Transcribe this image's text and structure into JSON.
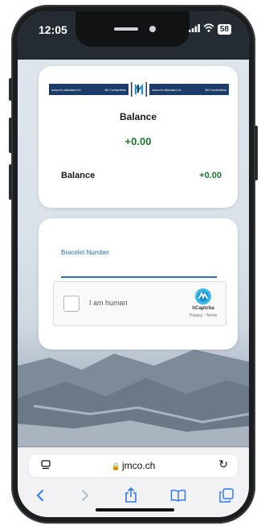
{
  "status_bar": {
    "time": "12:05",
    "battery": "58"
  },
  "banner": {
    "left_url": "www.eh-allandani.ch",
    "left_brand": "JM Contactless",
    "right_url": "www.eh-allandani.ch",
    "right_brand": "JM Contactless"
  },
  "balance_card": {
    "title": "Balance",
    "amount": "+0.00",
    "row_label": "Balance",
    "row_value": "+0.00"
  },
  "form_card": {
    "bracelet_label": "Bracelet Number",
    "bracelet_value": "",
    "captcha_label": "I am human",
    "captcha_brand": "hCaptcha",
    "captcha_links": "Privacy - Terms"
  },
  "browser": {
    "url": "jmco.ch"
  },
  "icons": {
    "status": [
      "signal-icon",
      "wifi-icon",
      "battery-icon"
    ],
    "address_bar": [
      "page-menu-icon",
      "lock-icon",
      "reload-icon"
    ],
    "toolbar": [
      "back-icon",
      "forward-icon",
      "share-icon",
      "bookmarks-icon",
      "tabs-icon"
    ]
  },
  "colors": {
    "accent_blue": "#2d6fb0",
    "balance_green": "#1e7a2e",
    "banner_navy": "#1b3c6b",
    "safari_blue": "#2f7bf6"
  }
}
